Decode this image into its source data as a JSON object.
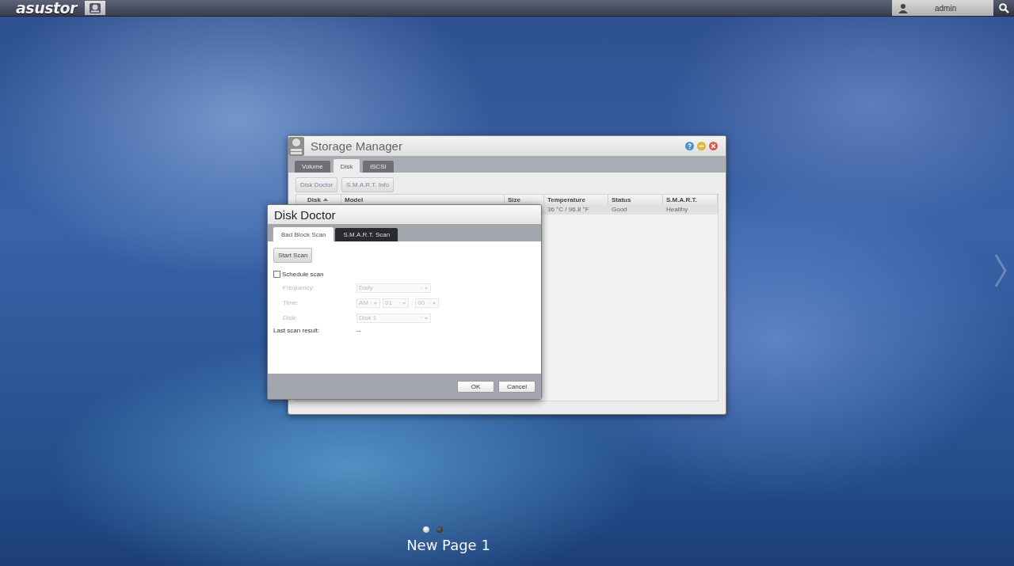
{
  "top_bar": {
    "logo": "asustor",
    "user": "admin"
  },
  "storage_manager": {
    "title": "Storage Manager",
    "tabs": [
      {
        "label": "Volume",
        "selected": false
      },
      {
        "label": "Disk",
        "selected": true
      },
      {
        "label": "iSCSI",
        "selected": false
      }
    ],
    "toolbar": [
      "Disk Doctor",
      "S.M.A.R.T. Info"
    ],
    "table": {
      "columns": [
        {
          "label": "Disk",
          "sorted": true
        },
        {
          "label": "Model",
          "sorted": false
        },
        {
          "label": "Size",
          "sorted": false
        },
        {
          "label": "Temperature",
          "sorted": false
        },
        {
          "label": "Status",
          "sorted": false
        },
        {
          "label": "S.M.A.R.T.",
          "sorted": false
        }
      ],
      "rows": [
        {
          "selected": true,
          "cells": [
            "",
            "",
            "",
            "36 °C / 96.8 °F",
            "Good",
            "Healthy"
          ]
        }
      ]
    }
  },
  "disk_doctor": {
    "title": "Disk Doctor",
    "tabs": [
      {
        "label": "Bad Block Scan",
        "selected": true
      },
      {
        "label": "S.M.A.R.T. Scan",
        "selected": false
      }
    ],
    "start_button": "Start Scan",
    "schedule": {
      "label": "Schedule scan",
      "checked": false
    },
    "fields": [
      {
        "label": "Frequency:",
        "disabled": true,
        "selects": [
          "Daily"
        ]
      },
      {
        "label": "Time:",
        "disabled": true,
        "selects": [
          "AM",
          "01",
          "00"
        ],
        "separator": ":"
      },
      {
        "label": "Disk:",
        "disabled": true,
        "selects": [
          "Disk 1"
        ]
      }
    ],
    "last_scan": {
      "label": "Last scan result:",
      "value": "--"
    },
    "buttons": [
      "OK",
      "Cancel"
    ]
  },
  "pager": {
    "dots": [
      {
        "selected": true
      },
      {
        "selected": false
      }
    ],
    "label": "New Page 1"
  }
}
